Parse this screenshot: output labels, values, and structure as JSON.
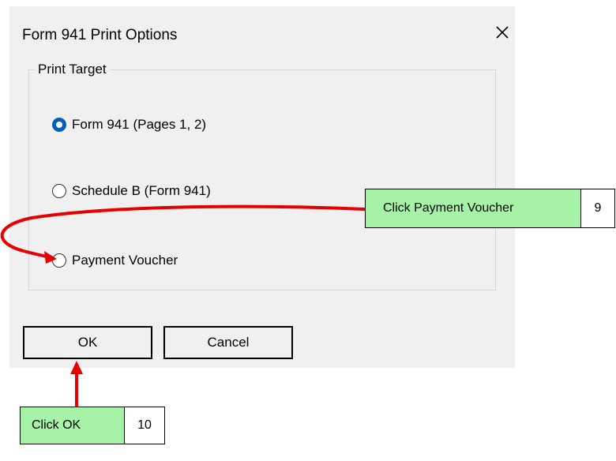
{
  "dialog": {
    "title": "Form 941 Print Options",
    "close_icon": "close-icon",
    "group_label": "Print Target",
    "options": [
      {
        "label": "Form 941 (Pages 1, 2)",
        "checked": true
      },
      {
        "label": "Schedule B (Form 941)",
        "checked": false
      },
      {
        "label": "Payment Voucher",
        "checked": false
      }
    ],
    "ok_label": "OK",
    "cancel_label": "Cancel"
  },
  "annotations": {
    "voucher_callout": {
      "text": "Click Payment Voucher",
      "step": "9"
    },
    "ok_callout": {
      "text": "Click OK",
      "step": "10"
    }
  },
  "colors": {
    "radio_selected": "#005fb8",
    "callout_fill": "#a6f2a6",
    "arrow": "#e60000",
    "dialog_bg": "#f0f0f0"
  }
}
